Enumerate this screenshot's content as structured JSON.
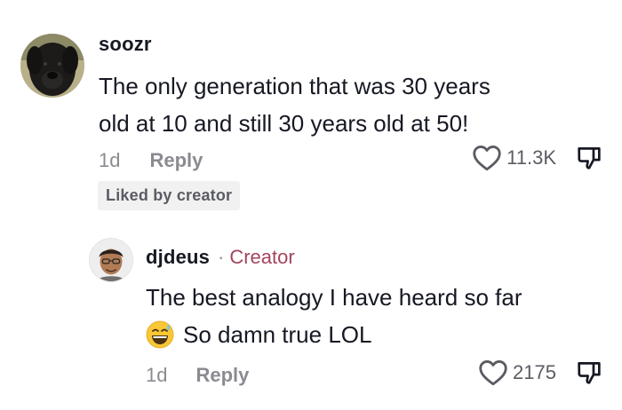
{
  "comments": [
    {
      "username": "soozr",
      "lines": [
        "The only generation that was 30 years",
        "old at 10 and still 30 years old at 50!"
      ],
      "time": "1d",
      "reply_label": "Reply",
      "like_count": "11.3K",
      "badge": "Liked by creator",
      "avatar_icon": "dog-avatar"
    },
    {
      "username": "djdeus",
      "separator": "·",
      "creator_label": "Creator",
      "lines": [
        "The best analogy I have heard so far",
        "So damn true LOL"
      ],
      "emoji_icon": "grinning-sweat-emoji",
      "time": "1d",
      "reply_label": "Reply",
      "like_count": "2175",
      "avatar_icon": "person-avatar"
    }
  ],
  "colors": {
    "text": "#161823",
    "muted": "#8a8b91",
    "creator": "#a3455f",
    "badge_bg": "#f1f1f2"
  }
}
